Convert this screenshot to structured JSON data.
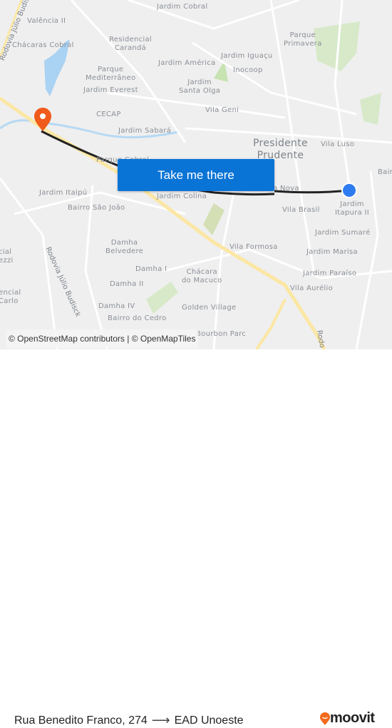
{
  "map": {
    "labels": {
      "jardim_cobral": "Jardim Cobral",
      "valencia_ii": "Valência II",
      "chacaras_cobral": "Chácaras Cobral",
      "residencial_caranda": "Residencial\nCarandá",
      "parque_primavera": "Parque\nPrimavera",
      "jardim_iguacu": "Jardim Iguaçu",
      "jardim_america": "Jardim América",
      "inocoop": "Inocoop",
      "parque_mediterraneo": "Parque\nMediterrâneo",
      "jardim_everest": "Jardim Everest",
      "jardim_santa_olga": "Jardim\nSanta Olga",
      "cecap": "CECAP",
      "vila_geni": "Vila Geni",
      "jardim_sabara": "Jardim Sabará",
      "presidente_prudente": "Presidente\nPrudente",
      "vila_luso": "Vila Luso",
      "bairro_edge": "Bair",
      "parque_cobral": "Parque Cobral",
      "jardim_itaipu": "Jardim Itaipú",
      "jardim_colina": "Jardim Colina",
      "vila_nova": "Vila Nova",
      "jardim_itapura_ii": "Jardim\nItapura II",
      "bairro_sao_joao": "Bairro São João",
      "vila_brasil": "Vila Brasil",
      "jardim_sumare": "Jardim Sumaré",
      "damha_belvedere": "Damha\nBelvedere",
      "vila_formosa": "Vila Formosa",
      "jardim_marisa": "Jardim Marisa",
      "cial_ezzi": "cial\nezzi",
      "damha_i": "Damha I",
      "chacara_do_macuco": "Chácara\ndo Macuco",
      "jardim_paraiso": "Jardim Paraíso",
      "damha_ii": "Damha II",
      "vila_aurelio": "Vila Aurélio",
      "encial_carlo": "encial\nCarlo",
      "damha_iv": "Damha IV",
      "golden_village": "Golden Village",
      "bairro_do_cedro": "Bairro do Cedro",
      "bourbon_parc": "Bourbon Parc"
    },
    "road_labels": {
      "rodovia_top": "Rodovia Júlio Budisck",
      "rodovia_bottom": "Rodovia Júlio Budisck",
      "rodo_right": "Rodo"
    },
    "cta_label": "Take me there",
    "attribution": "© OpenStreetMap contributors | © OpenMapTiles",
    "colors": {
      "destination_pin": "#f05a1a",
      "origin_dot": "#2f7bf0",
      "route_line": "#222222",
      "cta": "#0a74d6",
      "highway": "#fbe7a4",
      "water": "#a9d2f3",
      "park": "#cfe6bf"
    }
  },
  "footer": {
    "origin": "Rua Benedito Franco, 274",
    "arrow": "⟶",
    "destination": "EAD Unoeste",
    "brand": "moovit"
  }
}
